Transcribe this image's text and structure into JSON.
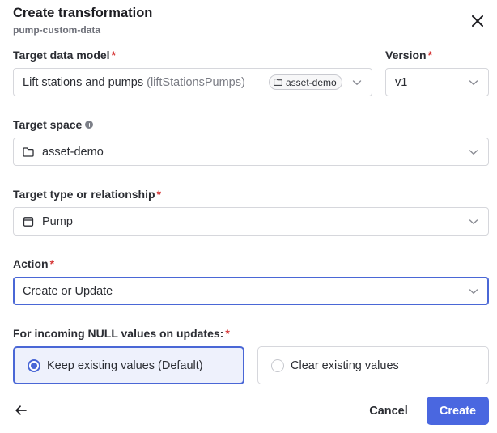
{
  "dialog": {
    "title": "Create transformation",
    "subtitle": "pump-custom-data"
  },
  "fields": {
    "target_data_model": {
      "label": "Target data model",
      "required": "*",
      "value": "Lift stations and pumps",
      "external_id": "(liftStationsPumps)",
      "space_chip": "asset-demo"
    },
    "version": {
      "label": "Version",
      "required": "*",
      "value": "v1"
    },
    "target_space": {
      "label": "Target space",
      "value": "asset-demo",
      "icon": "folder-icon"
    },
    "target_type": {
      "label": "Target type or relationship",
      "required": "*",
      "value": "Pump",
      "icon": "type-icon"
    },
    "action": {
      "label": "Action",
      "required": "*",
      "value": "Create or Update"
    },
    "null_values": {
      "label": "For incoming NULL values on updates:",
      "required": "*",
      "options": [
        {
          "label": "Keep existing values (Default)",
          "selected": true
        },
        {
          "label": "Clear existing values",
          "selected": false
        }
      ]
    }
  },
  "footer": {
    "cancel_label": "Cancel",
    "create_label": "Create"
  },
  "colors": {
    "accent": "#4a67e0",
    "required": "#d63a3a",
    "border": "#d6d7dc"
  }
}
